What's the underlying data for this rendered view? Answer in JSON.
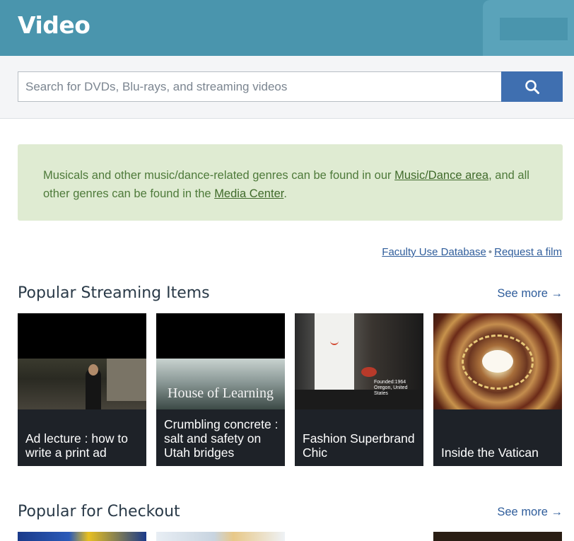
{
  "header": {
    "title": "Video"
  },
  "search": {
    "placeholder": "Search for DVDs, Blu-rays, and streaming videos",
    "value": ""
  },
  "notice": {
    "text_1": "Musicals and other music/dance-related genres can be found in our ",
    "link_1": "Music/Dance area",
    "text_2": ", and all other genres can be found in the ",
    "link_2": "Media Center",
    "text_3": "."
  },
  "links": {
    "faculty": "Faculty Use Database",
    "separator": "•",
    "request": "Request a film"
  },
  "streaming": {
    "title": "Popular Streaming Items",
    "see_more": "See more →",
    "items": [
      {
        "title": "Ad lecture : how to write a print ad"
      },
      {
        "title": "Crumbling concrete : salt and safety on Utah bridges",
        "thumb_caption": "House of Learning"
      },
      {
        "title": "Fashion Superbrand Chic",
        "thumb_caption": "Founded:1964 Oregon, United States"
      },
      {
        "title": "Inside the Vatican"
      }
    ]
  },
  "checkout": {
    "title": "Popular for Checkout",
    "see_more": "See more →"
  },
  "colors": {
    "header": "#4a95ad",
    "search_button": "#3f6fb0",
    "notice_bg": "#dfebd2",
    "link": "#2f5d9b"
  },
  "icons": {
    "search": "magnifier-icon",
    "arrow": "arrow-right-icon"
  }
}
